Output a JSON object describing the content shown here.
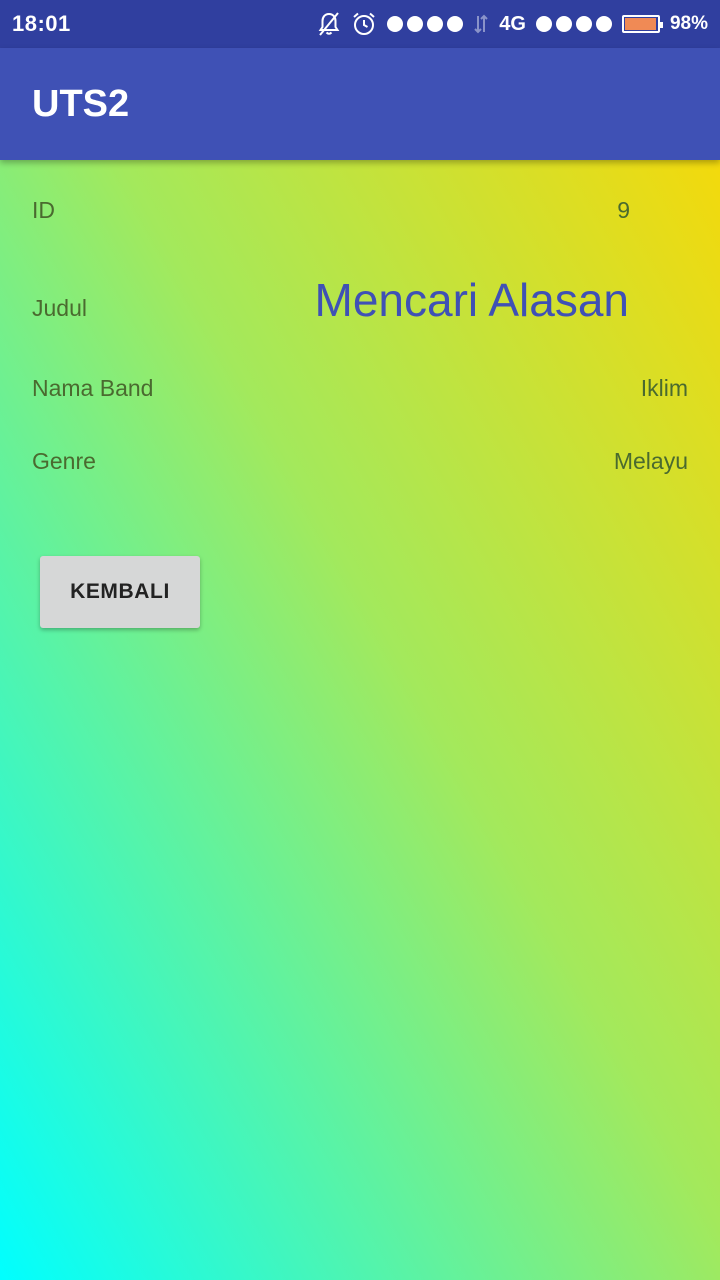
{
  "status_bar": {
    "time": "18:01",
    "network": "4G",
    "battery_percent": "98%",
    "battery_level": 0.98,
    "battery_color": "#f08a55",
    "icons": [
      "mute-notifications-icon",
      "alarm-icon",
      "signal-dots-icon",
      "data-transfer-icon",
      "signal-dots-icon",
      "battery-icon"
    ]
  },
  "app_bar": {
    "title": "UTS2",
    "color": "#3f51b5"
  },
  "details": {
    "id": {
      "label": "ID",
      "value": "9"
    },
    "judul": {
      "label": "Judul",
      "value": "Mencari Alasan"
    },
    "nama_band": {
      "label": "Nama Band",
      "value": "Iklim"
    },
    "genre": {
      "label": "Genre",
      "value": "Melayu"
    }
  },
  "buttons": {
    "back_label": "KEMBALI"
  },
  "colors": {
    "gradient_bottom_left": "#00ffff",
    "gradient_top_right": "#ffd700",
    "status_bar": "#303f9f"
  }
}
